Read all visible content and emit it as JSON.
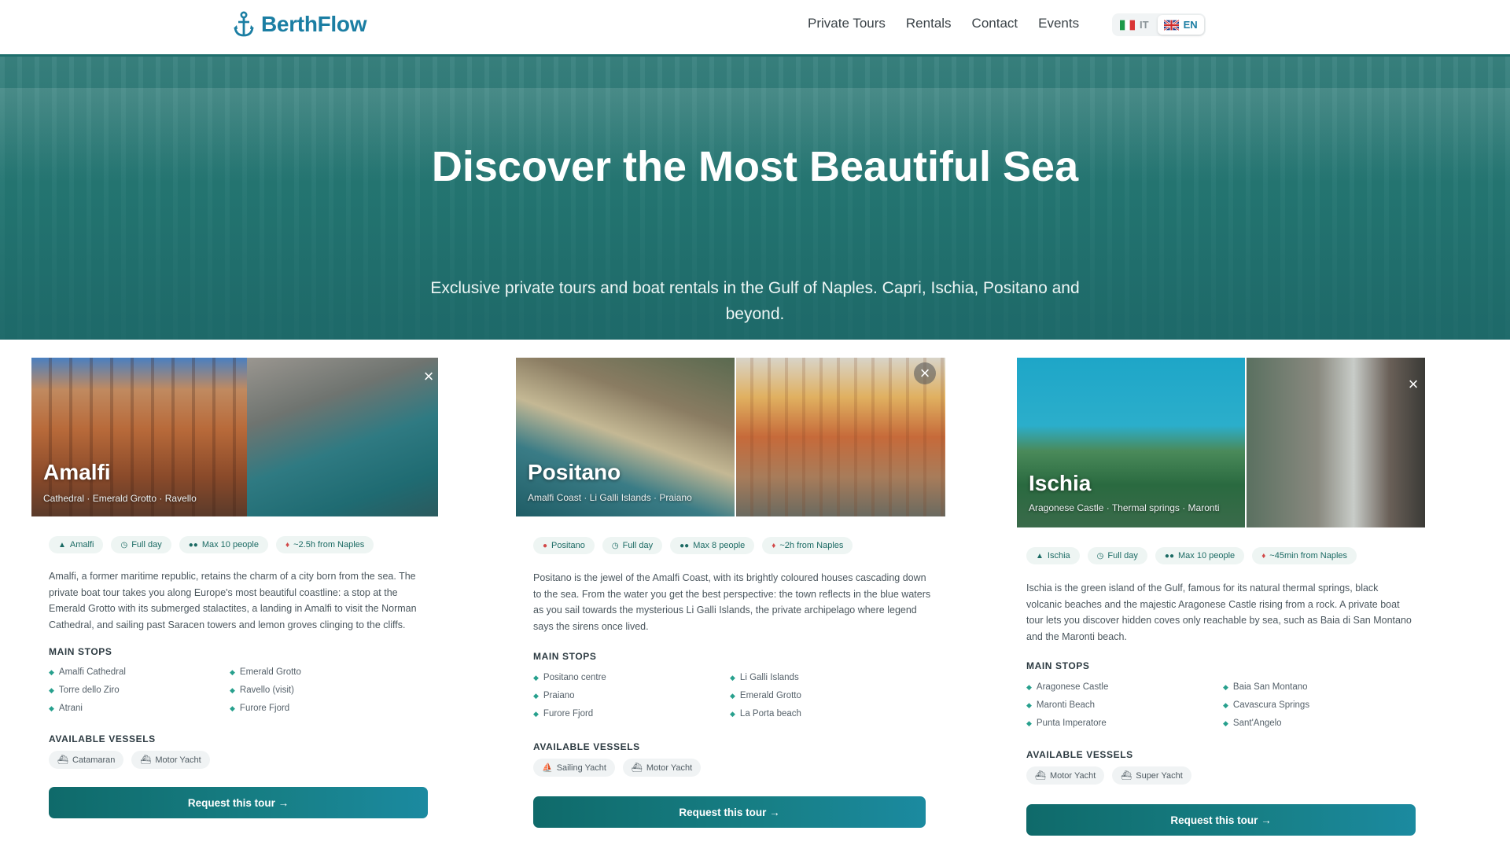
{
  "brand": {
    "name": "BerthFlow"
  },
  "nav": [
    "Private Tours",
    "Rentals",
    "Contact",
    "Events"
  ],
  "lang": {
    "it": "IT",
    "en": "EN"
  },
  "hero": {
    "title": "Discover the Most Beautiful Sea",
    "subtitle": "Exclusive private tours and boat rentals in the Gulf of Naples. Capri, Ischia, Positano and beyond."
  },
  "colors": {
    "accent": "#1b7ea3",
    "teal": "#1e6e6c",
    "chip_bg": "#eef5f3"
  },
  "labels": {
    "main_stops": "MAIN STOPS",
    "vessels": "AVAILABLE VESSELS",
    "cta": "Request this tour →"
  },
  "tours": [
    {
      "name": "Amalfi",
      "sub": "Cathedral · Emerald Grotto · Ravello",
      "chips": [
        "Amalfi",
        "Full day",
        "Max 10 people",
        "~2.5h from Naples"
      ],
      "desc": "Amalfi, a former maritime republic, retains the charm of a city born from the sea. The private boat tour takes you along Europe's most beautiful coastline: a stop at the Emerald Grotto with its submerged stalactites, a landing in Amalfi to visit the Norman Cathedral, and sailing past Saracen towers and lemon groves clinging to the cliffs.",
      "stops": [
        "Amalfi Cathedral",
        "Emerald Grotto",
        "Torre dello Ziro",
        "Ravello (visit)",
        "Atrani",
        "Furore Fjord"
      ],
      "vessels": [
        "Catamaran",
        "Motor Yacht"
      ]
    },
    {
      "name": "Positano",
      "sub": "Amalfi Coast · Li Galli Islands · Praiano",
      "chips": [
        "Positano",
        "Full day",
        "Max 8 people",
        "~2h from Naples"
      ],
      "desc": "Positano is the jewel of the Amalfi Coast, with its brightly coloured houses cascading down to the sea. From the water you get the best perspective: the town reflects in the blue waters as you sail towards the mysterious Li Galli Islands, the private archipelago where legend says the sirens once lived.",
      "stops": [
        "Positano centre",
        "Li Galli Islands",
        "Praiano",
        "Emerald Grotto",
        "Furore Fjord",
        "La Porta beach"
      ],
      "vessels": [
        "Sailing Yacht",
        "Motor Yacht"
      ]
    },
    {
      "name": "Ischia",
      "sub": "Aragonese Castle · Thermal springs · Maronti",
      "chips": [
        "Ischia",
        "Full day",
        "Max 10 people",
        "~45min from Naples"
      ],
      "desc": "Ischia is the green island of the Gulf, famous for its natural thermal springs, black volcanic beaches and the majestic Aragonese Castle rising from a rock. A private boat tour lets you discover hidden coves only reachable by sea, such as Baia di San Montano and the Maronti beach.",
      "stops": [
        "Aragonese Castle",
        "Baia San Montano",
        "Maronti Beach",
        "Cavascura Springs",
        "Punta Imperatore",
        "Sant'Angelo"
      ],
      "vessels": [
        "Motor Yacht",
        "Super Yacht"
      ]
    }
  ]
}
